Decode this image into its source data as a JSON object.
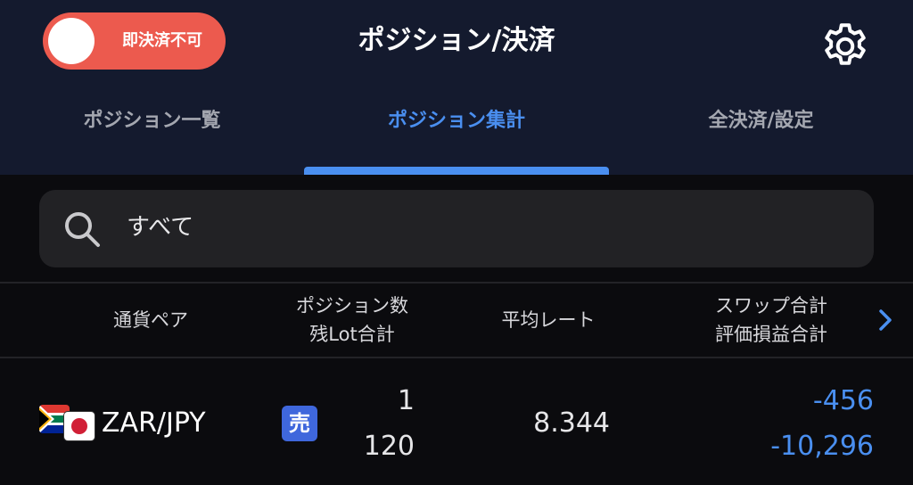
{
  "header": {
    "toggle_label": "即決済不可",
    "title": "ポジション/決済",
    "settings_icon": "gear-icon"
  },
  "tabs": [
    {
      "label": "ポジション一覧",
      "active": false
    },
    {
      "label": "ポジション集計",
      "active": true
    },
    {
      "label": "全決済/設定",
      "active": false
    }
  ],
  "search": {
    "icon": "search-icon",
    "value": "すべて"
  },
  "columns": {
    "pair": "通貨ペア",
    "position_count": "ポジション数",
    "remaining_lots": "残Lot合計",
    "avg_rate": "平均レート",
    "swap_total": "スワップ合計",
    "valuation_total": "評価損益合計",
    "next_icon": "chevron-right-icon"
  },
  "rows": [
    {
      "pair": "ZAR/JPY",
      "flags": [
        "south-africa-flag",
        "japan-flag"
      ],
      "side": "売",
      "position_count": "1",
      "remaining_lots": "120",
      "avg_rate": "8.344",
      "swap_total": "-456",
      "valuation_total": "-10,296"
    }
  ],
  "colors": {
    "accent": "#4a8ff0",
    "toggle_red": "#ec5a4e",
    "header_bg": "#141a2e",
    "sell_badge": "#3f67dc"
  }
}
